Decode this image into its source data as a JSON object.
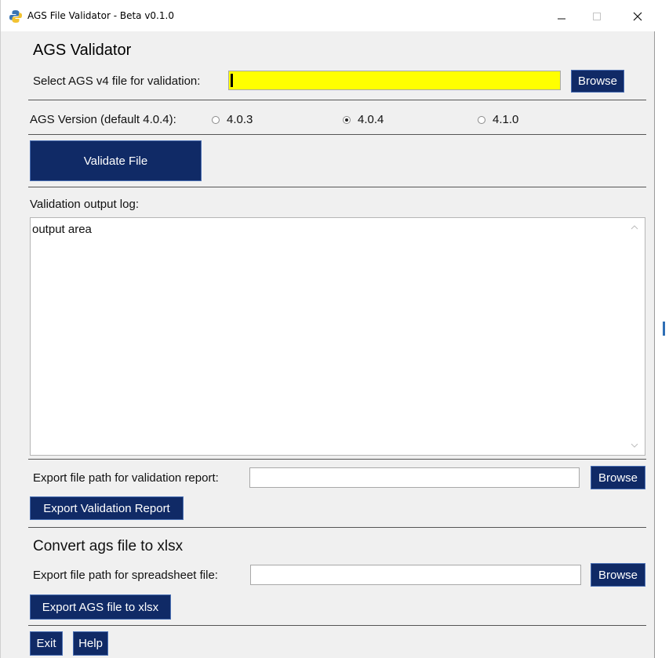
{
  "window": {
    "title": "AGS File Validator - Beta v0.1.0",
    "icon": "python-icon"
  },
  "validator": {
    "heading": "AGS Validator",
    "select_label": "Select AGS v4 file for validation:",
    "file_value": "",
    "browse_label": "Browse"
  },
  "version": {
    "label": "AGS Version (default 4.0.4):",
    "options": [
      {
        "label": "4.0.3",
        "selected": false
      },
      {
        "label": "4.0.4",
        "selected": true
      },
      {
        "label": "4.1.0",
        "selected": false
      }
    ]
  },
  "actions": {
    "validate_label": "Validate File"
  },
  "log": {
    "label": "Validation output log:",
    "content": "output area"
  },
  "export_report": {
    "label": "Export file path for validation report:",
    "value": "",
    "browse_label": "Browse",
    "button_label": "Export Validation Report"
  },
  "convert": {
    "heading": "Convert ags file to xlsx",
    "label": "Export file path for spreadsheet file:",
    "value": "",
    "browse_label": "Browse",
    "button_label": "Export AGS file to xlsx"
  },
  "footer": {
    "exit_label": "Exit",
    "help_label": "Help"
  },
  "colors": {
    "button_bg": "#102a66",
    "button_text": "#ffffff",
    "highlight_field": "#ffff00",
    "window_bg": "#f0f0f0"
  }
}
